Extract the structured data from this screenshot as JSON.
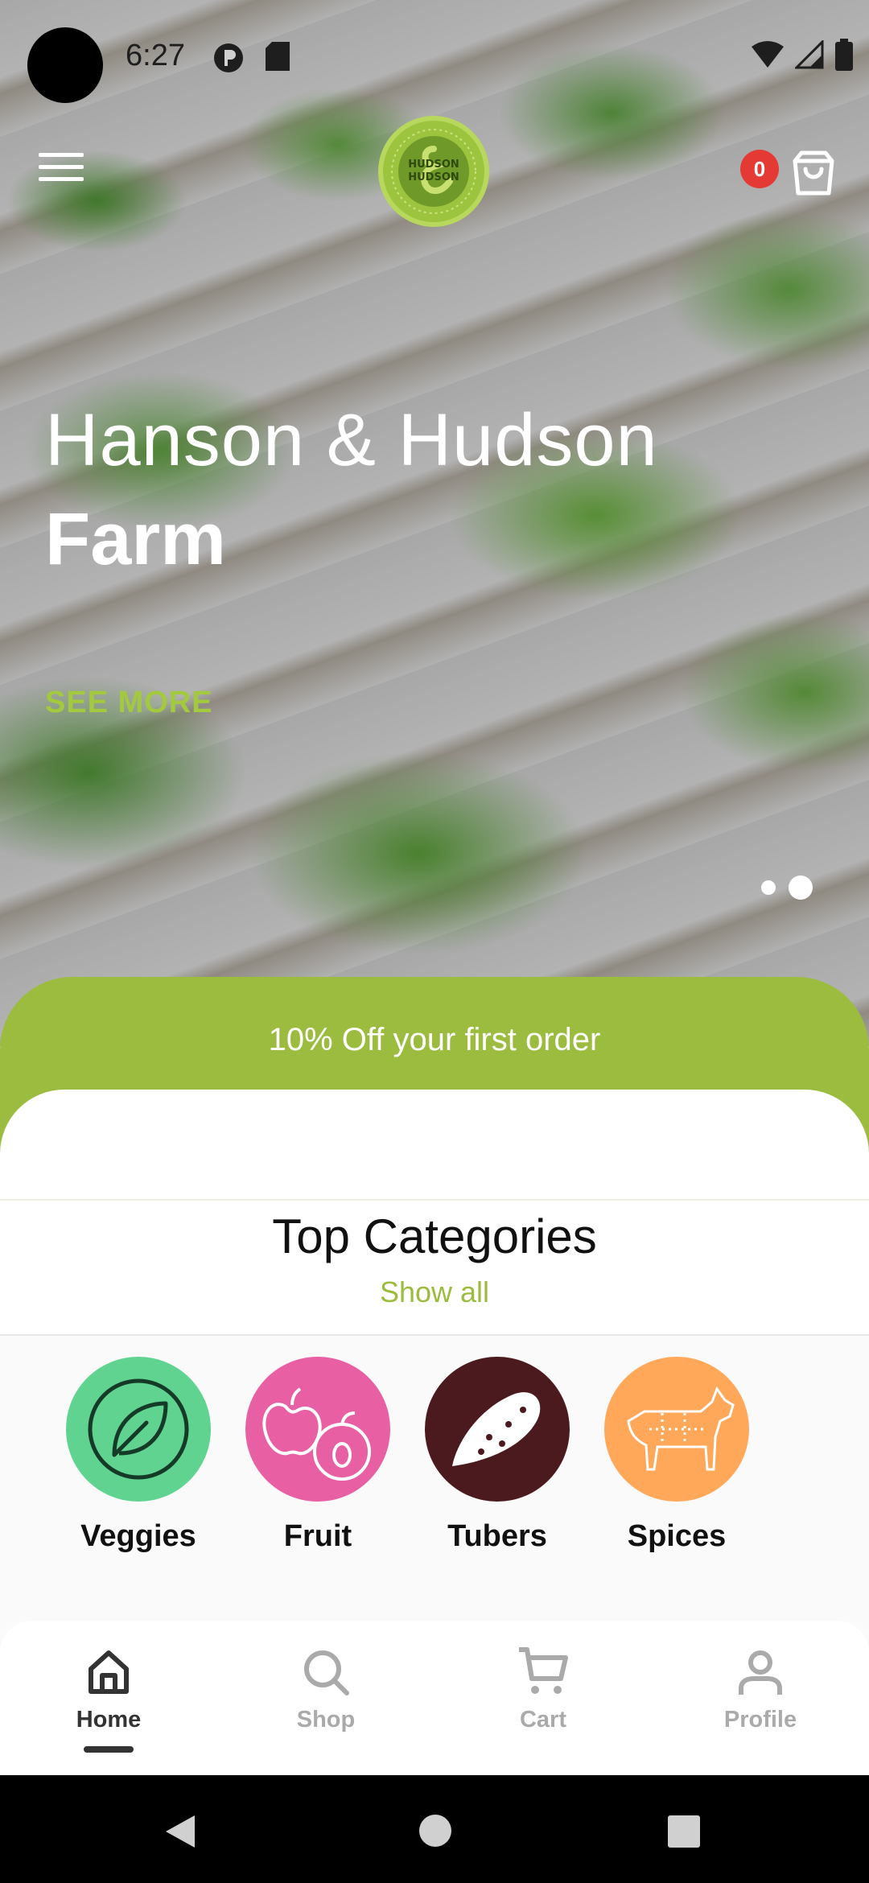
{
  "status_bar": {
    "time": "6:27"
  },
  "header": {
    "cart_count": "0",
    "logo_icon": "farm-logo"
  },
  "hero": {
    "title_line1": "Hanson & Hudson",
    "title_line2": "Farm",
    "cta": "SEE MORE",
    "slides_total": 2,
    "active_slide": 2
  },
  "promo": {
    "text": "10% Off your first order"
  },
  "categories_section": {
    "title": "Top Categories",
    "show_all": "Show all",
    "items": [
      {
        "label": "Veggies",
        "color": "#5fd38f",
        "icon": "leaf-icon"
      },
      {
        "label": "Fruit",
        "color": "#e85fa3",
        "icon": "apple-icon"
      },
      {
        "label": "Tubers",
        "color": "#4a1a1e",
        "icon": "sweet-potato-icon"
      },
      {
        "label": "Spices",
        "color": "#ffa85a",
        "icon": "cow-icon"
      }
    ]
  },
  "bottom_nav": {
    "items": [
      {
        "label": "Home",
        "icon": "home-icon",
        "active": true
      },
      {
        "label": "Shop",
        "icon": "search-icon",
        "active": false
      },
      {
        "label": "Cart",
        "icon": "cart-icon",
        "active": false
      },
      {
        "label": "Profile",
        "icon": "profile-icon",
        "active": false
      }
    ]
  },
  "colors": {
    "accent": "#9bbc3e",
    "badge": "#e53935"
  }
}
